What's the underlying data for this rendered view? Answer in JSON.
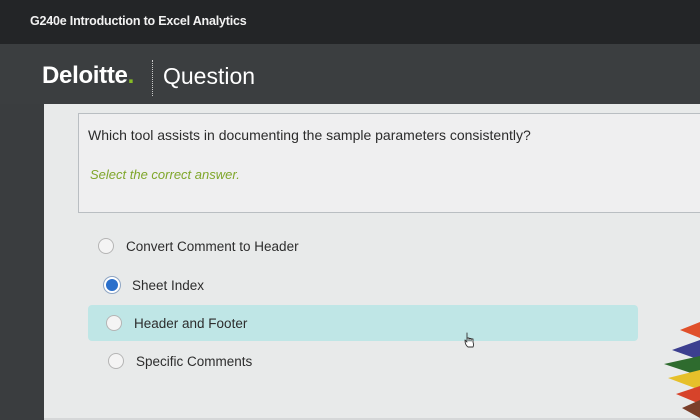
{
  "app": {
    "course_title": "G240e Introduction to Excel Analytics"
  },
  "header": {
    "brand": "Deloitte",
    "brand_dot": ".",
    "section_title": "Question"
  },
  "question": {
    "text": "Which tool assists in documenting the sample parameters consistently?",
    "instruction": "Select the correct answer."
  },
  "options": [
    {
      "label": "Convert Comment to Header",
      "selected": false,
      "highlighted": false
    },
    {
      "label": "Sheet Index",
      "selected": true,
      "highlighted": false
    },
    {
      "label": "Header and Footer",
      "selected": false,
      "highlighted": true
    },
    {
      "label": "Specific Comments",
      "selected": false,
      "highlighted": false
    }
  ],
  "colors": {
    "brand_accent": "#86bc25",
    "highlight": "#bfe6e6",
    "selected_radio": "#2a6fcb",
    "instruction": "#7fa62a"
  },
  "icons": [
    "hand-cursor-icon",
    "radio-selected-icon",
    "radio-unselected-icon"
  ]
}
